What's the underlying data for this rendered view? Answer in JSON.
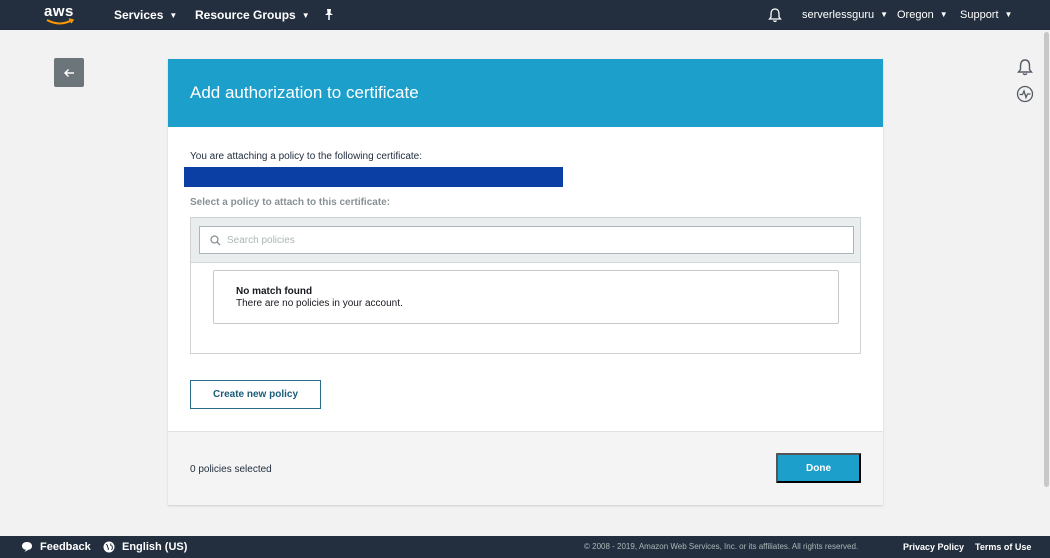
{
  "topnav": {
    "logo": "aws",
    "services": "Services",
    "resource_groups": "Resource Groups",
    "pin_icon": "pushpin-icon",
    "bell_icon": "bell-icon",
    "account": "serverlessguru",
    "region": "Oregon",
    "support": "Support"
  },
  "rail": {
    "notifications_icon": "bell-icon",
    "health_icon": "activity-icon"
  },
  "back_icon": "arrow-left-icon",
  "panel": {
    "title": "Add authorization to certificate",
    "attach_label": "You are attaching a policy to the following certificate:",
    "select_label": "Select a policy to attach to this certificate:",
    "search": {
      "placeholder": "Search policies",
      "value": ""
    },
    "empty": {
      "title": "No match found",
      "description": "There are no policies in your account."
    },
    "create_button": "Create new policy",
    "selected_count": "0 policies selected",
    "done_button": "Done"
  },
  "colors": {
    "nav_bg": "#232f3e",
    "header_blue": "#1d9fcc",
    "redaction_blue": "#0c3fa3",
    "accent_orange": "#ff9900"
  },
  "footer": {
    "feedback": "Feedback",
    "language": "English (US)",
    "copyright": "© 2008 - 2019, Amazon Web Services, Inc. or its affiliates. All rights reserved.",
    "privacy": "Privacy Policy",
    "terms": "Terms of Use"
  }
}
